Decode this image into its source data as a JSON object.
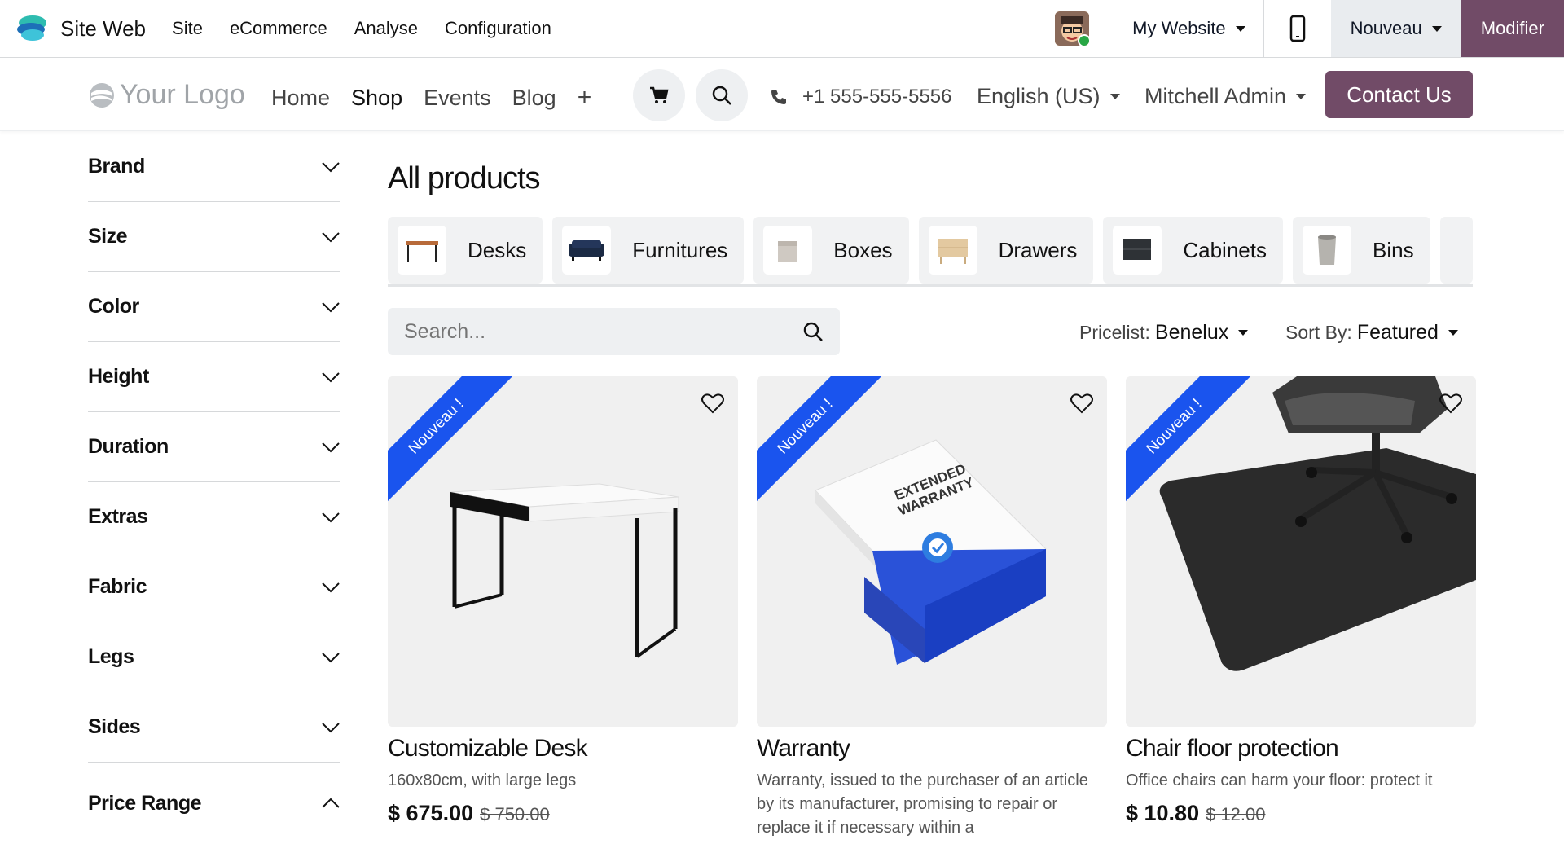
{
  "topbar": {
    "app_name": "Site Web",
    "menus": [
      "Site",
      "eCommerce",
      "Analyse",
      "Configuration"
    ],
    "website": "My Website",
    "new_label": "Nouveau",
    "edit_label": "Modifier"
  },
  "header": {
    "logo_text": "Your Logo",
    "nav": [
      "Home",
      "Shop",
      "Events",
      "Blog"
    ],
    "add_label": "+",
    "phone": "+1 555-555-5556",
    "language": "English (US)",
    "user": "Mitchell Admin",
    "contact_label": "Contact Us"
  },
  "filters": [
    "Brand",
    "Size",
    "Color",
    "Height",
    "Duration",
    "Extras",
    "Fabric",
    "Legs",
    "Sides",
    "Price Range"
  ],
  "main": {
    "title": "All products",
    "categories": [
      "Desks",
      "Furnitures",
      "Boxes",
      "Drawers",
      "Cabinets",
      "Bins"
    ],
    "search_placeholder": "Search...",
    "pricelist_label": "Pricelist:",
    "pricelist_value": "Benelux",
    "sort_label": "Sort By:",
    "sort_value": "Featured"
  },
  "products": [
    {
      "ribbon": "Nouveau !",
      "name": "Customizable Desk",
      "desc": "160x80cm, with large legs",
      "price": "$ 675.00",
      "old_price": "$ 750.00"
    },
    {
      "ribbon": "Nouveau !",
      "name": "Warranty",
      "desc": "Warranty, issued to the purchaser of an article by its manufacturer, promising to repair or replace it if necessary within a",
      "price": "",
      "old_price": "",
      "box_text": "EXTENDED WARRANTY"
    },
    {
      "ribbon": "Nouveau !",
      "name": "Chair floor protection",
      "desc": "Office chairs can harm your floor: protect it",
      "price": "$ 10.80",
      "old_price": "$ 12.00"
    }
  ],
  "colors": {
    "brand": "#714b67",
    "ribbon": "#1a54ee"
  }
}
